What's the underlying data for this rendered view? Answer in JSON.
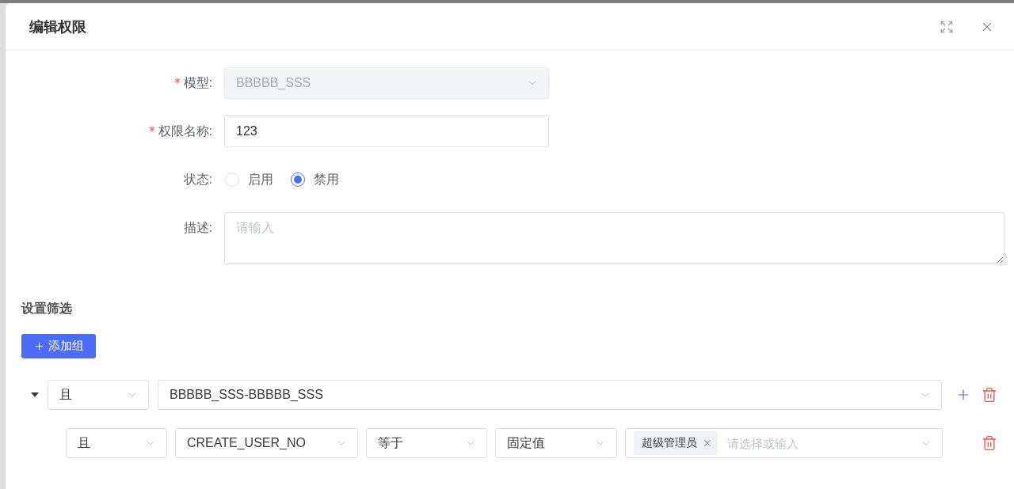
{
  "dialog": {
    "title": "编辑权限"
  },
  "form": {
    "fields": [
      {
        "kind": "select",
        "label": "模型:",
        "required": true,
        "disabled": true,
        "value": "BBBBB_SSS"
      },
      {
        "kind": "input",
        "label": "权限名称:",
        "required": true,
        "disabled": false,
        "value": "123"
      },
      {
        "kind": "radio",
        "label": "状态:",
        "required": false,
        "options": [
          {
            "label": "启用",
            "selected": false
          },
          {
            "label": "禁用",
            "selected": true
          }
        ]
      },
      {
        "kind": "textarea",
        "label": "描述:",
        "required": false,
        "placeholder": "请输入"
      }
    ]
  },
  "filter": {
    "title": "设置筛选",
    "add_group_button": "添加组",
    "groups": [
      {
        "expanded": true,
        "logic": "且",
        "table": "BBBBB_SSS-BBBBB_SSS",
        "conditions": [
          {
            "logic": "且",
            "field": "CREATE_USER_NO",
            "operator": "等于",
            "value_type": "固定值",
            "tags": [
              "超级管理员"
            ],
            "placeholder": "请选择或输入"
          }
        ]
      }
    ]
  }
}
